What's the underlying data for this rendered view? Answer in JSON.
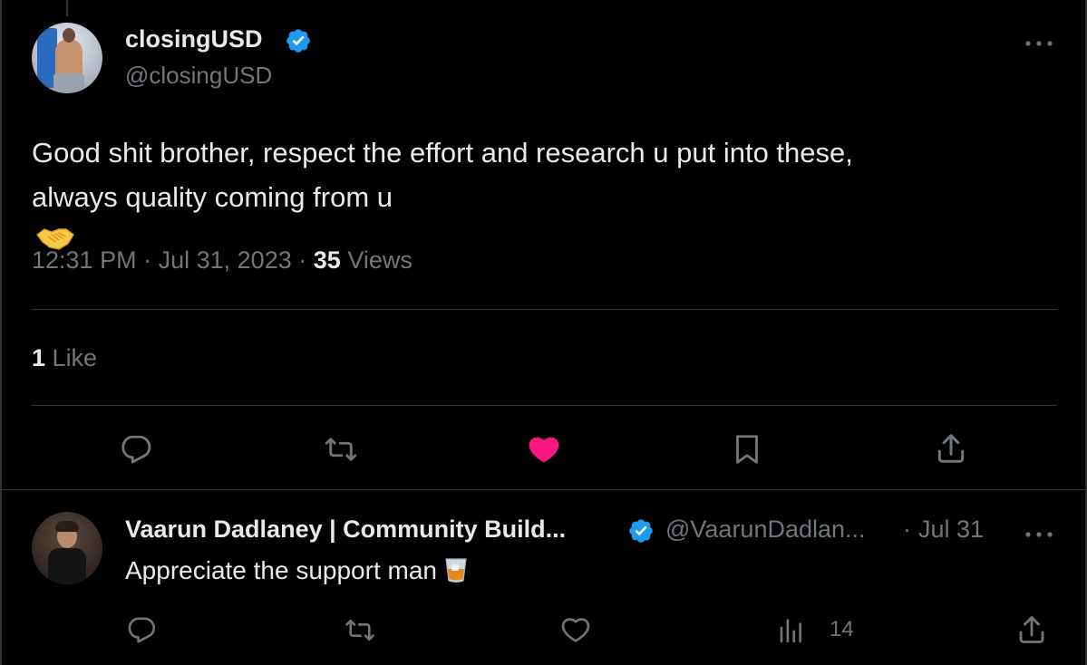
{
  "tweet": {
    "author_name": "closingUSD",
    "author_handle": "@closingUSD",
    "text_line1": "Good shit brother, respect the effort and research u put into these,",
    "text_line2": "always quality coming from u",
    "emoji": "handshake-emoji",
    "time": "12:31 PM",
    "separator": "·",
    "date": "Jul 31, 2023",
    "views_count": "35",
    "views_label": "Views",
    "likes_count": "1",
    "likes_label": "Like",
    "liked": true
  },
  "reply": {
    "author_name": "Vaarun Dadlaney | Community Build...",
    "author_handle": "@VaarunDadlan...",
    "separator": "·",
    "date": "Jul 31",
    "text": "Appreciate the support man",
    "emoji": "tumbler-glass-emoji",
    "views_count": "14"
  },
  "colors": {
    "background": "#000000",
    "text_primary": "#e7e9ea",
    "text_secondary": "#71767b",
    "verified_blue": "#1d9bf0",
    "like_pink": "#f91880",
    "divider": "#2f3336"
  },
  "icons": {
    "actions": [
      "reply-icon",
      "retweet-icon",
      "like-icon",
      "bookmark-icon",
      "share-icon"
    ],
    "reply_actions": [
      "reply-icon",
      "retweet-icon",
      "like-icon",
      "views-icon",
      "share-icon"
    ]
  }
}
